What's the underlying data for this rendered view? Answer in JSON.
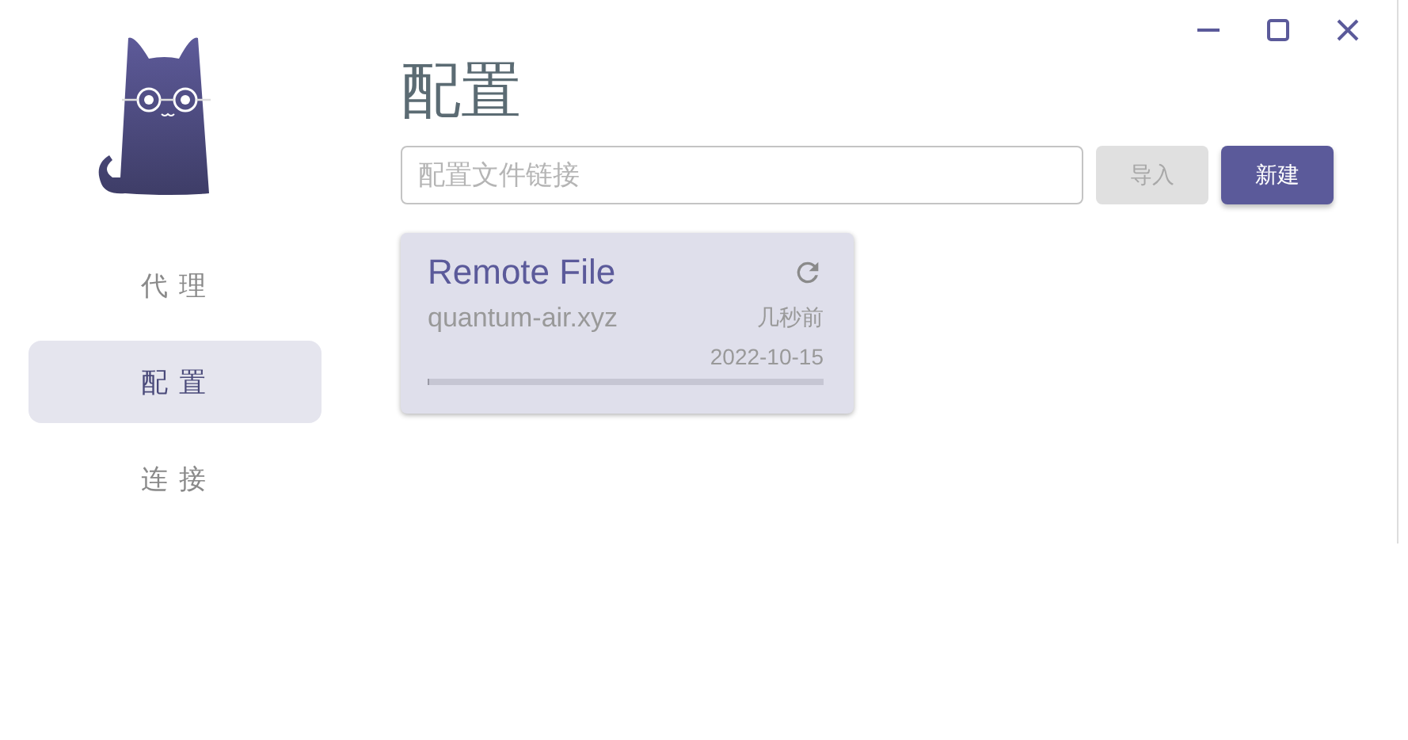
{
  "sidebar": {
    "items": [
      {
        "label": "代 理",
        "selected": false
      },
      {
        "label": "配 置",
        "selected": true
      },
      {
        "label": "连 接",
        "selected": false
      }
    ]
  },
  "page": {
    "title": "配置"
  },
  "import_bar": {
    "placeholder": "配置文件链接",
    "import_button": {
      "label": "导入",
      "disabled": true
    },
    "new_button": {
      "label": "新建"
    }
  },
  "profiles": [
    {
      "name": "Remote File",
      "host": "quantum-air.xyz",
      "updated": "几秒前",
      "expire": "2022-10-15",
      "level": 0.004
    }
  ]
}
